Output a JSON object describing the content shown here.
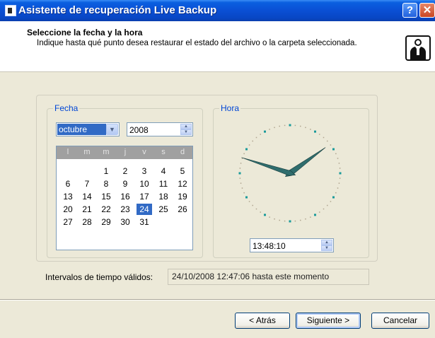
{
  "window": {
    "title": "Asistente de recuperación Live Backup",
    "help_label": "?",
    "close_label": "✕"
  },
  "header": {
    "title": "Seleccione la fecha y la hora",
    "description": "Indique hasta qué punto desea restaurar el estado del archivo o la carpeta seleccionada."
  },
  "date": {
    "group_label": "Fecha",
    "month": "octubre",
    "year": "2008",
    "weekdays": [
      "l",
      "m",
      "m",
      "j",
      "v",
      "s",
      "d"
    ],
    "days": [
      1,
      2,
      3,
      4,
      5,
      6,
      7,
      8,
      9,
      10,
      11,
      12,
      13,
      14,
      15,
      16,
      17,
      18,
      19,
      20,
      21,
      22,
      23,
      24,
      25,
      26,
      27,
      28,
      29,
      30,
      31
    ],
    "first_weekday_index": 2,
    "selected_day": 24
  },
  "time": {
    "group_label": "Hora",
    "value": "13:48:10",
    "clock_hours": 13,
    "clock_minutes": 48
  },
  "valid_interval": {
    "label": "Intervalos de tiempo válidos:",
    "value": "24/10/2008 12:47:06 hasta este momento"
  },
  "buttons": {
    "back": "< Atrás",
    "next": "Siguiente >",
    "cancel": "Cancelar"
  },
  "icons": {
    "dropdown": "chevron-down-icon",
    "spin": "spin-arrows-icon",
    "wizard": "user-icon"
  },
  "colors": {
    "title_bar": "#0A4FD4",
    "accent": "#316AC5",
    "group_label": "#0046D5",
    "dialog_bg": "#ECE9D8"
  }
}
